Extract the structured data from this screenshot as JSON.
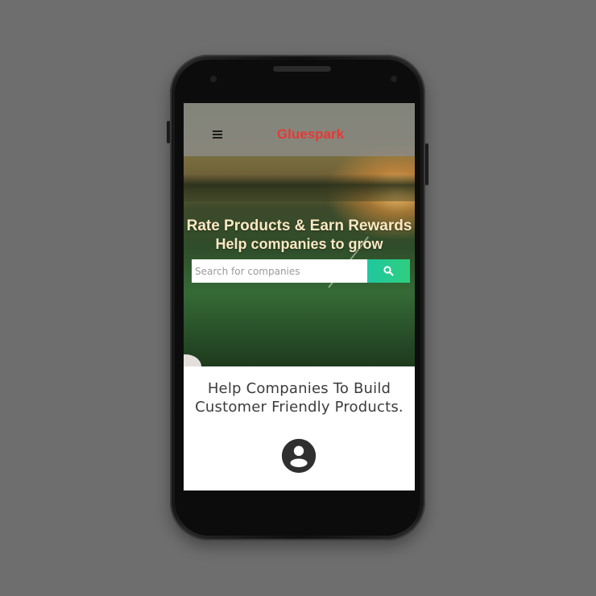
{
  "app": {
    "brand": "Gluespark",
    "brand_color": "#e53935",
    "menu_icon": "hamburger-menu-icon"
  },
  "hero": {
    "headline_line1": "Rate Products & Earn Rewards",
    "headline_line2": "Help companies to grow"
  },
  "search": {
    "placeholder": "Search for companies",
    "value": "",
    "button_icon": "search-icon",
    "button_color": "#1fc7a0"
  },
  "content": {
    "tagline_line1": "Help Companies To Build",
    "tagline_line2": "Customer Friendly Products.",
    "feature_icon": "account-circle-icon"
  }
}
